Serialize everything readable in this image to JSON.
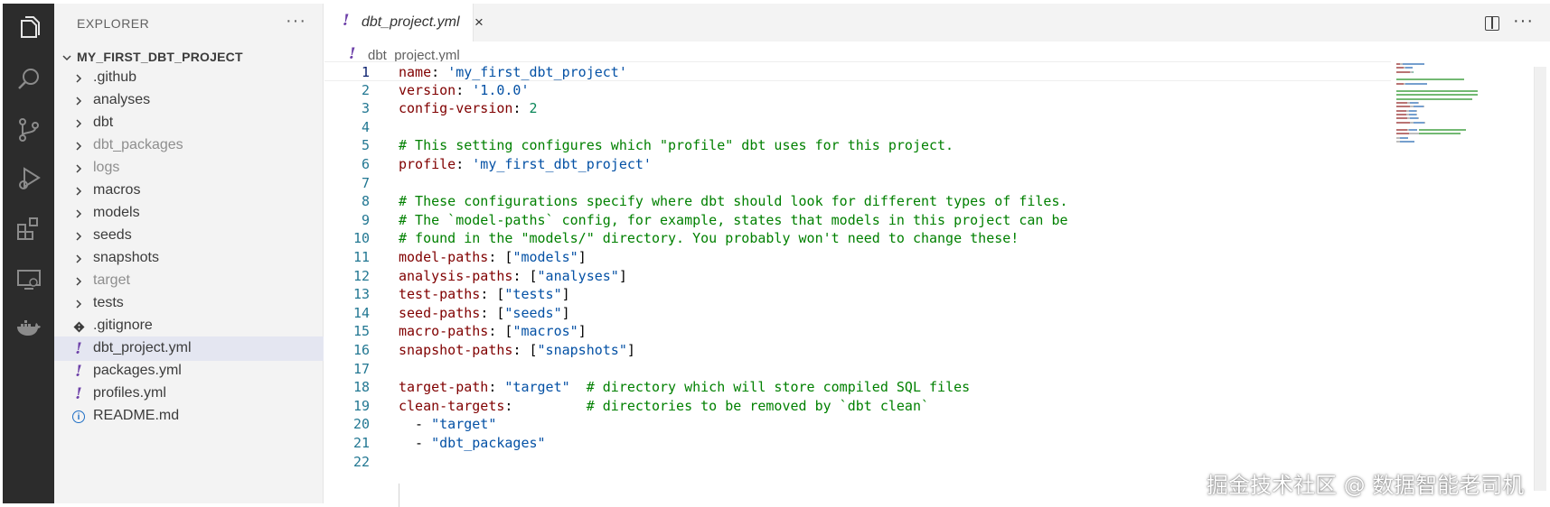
{
  "explorer": {
    "title": "EXPLORER",
    "more": "···",
    "project": "MY_FIRST_DBT_PROJECT",
    "items": [
      {
        "label": ".github",
        "type": "folder",
        "dim": false
      },
      {
        "label": "analyses",
        "type": "folder",
        "dim": false
      },
      {
        "label": "dbt",
        "type": "folder",
        "dim": false
      },
      {
        "label": "dbt_packages",
        "type": "folder",
        "dim": true
      },
      {
        "label": "logs",
        "type": "folder",
        "dim": true
      },
      {
        "label": "macros",
        "type": "folder",
        "dim": false
      },
      {
        "label": "models",
        "type": "folder",
        "dim": false
      },
      {
        "label": "seeds",
        "type": "folder",
        "dim": false
      },
      {
        "label": "snapshots",
        "type": "folder",
        "dim": false
      },
      {
        "label": "target",
        "type": "folder",
        "dim": true
      },
      {
        "label": "tests",
        "type": "folder",
        "dim": false
      },
      {
        "label": ".gitignore",
        "type": "git",
        "dim": false
      },
      {
        "label": "dbt_project.yml",
        "type": "yml",
        "dim": false,
        "selected": true
      },
      {
        "label": "packages.yml",
        "type": "yml",
        "dim": false
      },
      {
        "label": "profiles.yml",
        "type": "yml",
        "dim": false
      },
      {
        "label": "README.md",
        "type": "info",
        "dim": false
      }
    ]
  },
  "activity_bar": {
    "icons": [
      "files-icon",
      "search-icon",
      "source-control-icon",
      "run-debug-icon",
      "extensions-icon",
      "remote-explorer-icon",
      "docker-icon"
    ]
  },
  "editor": {
    "tab_label": "dbt_project.yml",
    "tab_close": "×",
    "breadcrumb": "dbt_project.yml",
    "more": "···",
    "yml_glyph": "!",
    "lines": [
      {
        "n": "1",
        "tokens": [
          [
            "k",
            "name"
          ],
          [
            "p",
            ": "
          ],
          [
            "s",
            "'my_first_dbt_project'"
          ]
        ],
        "current": true
      },
      {
        "n": "2",
        "tokens": [
          [
            "k",
            "version"
          ],
          [
            "p",
            ": "
          ],
          [
            "s",
            "'1.0.0'"
          ]
        ]
      },
      {
        "n": "3",
        "tokens": [
          [
            "k",
            "config-version"
          ],
          [
            "p",
            ": "
          ],
          [
            "n",
            "2"
          ]
        ]
      },
      {
        "n": "4",
        "tokens": []
      },
      {
        "n": "5",
        "tokens": [
          [
            "c",
            "# This setting configures which \"profile\" dbt uses for this project."
          ]
        ]
      },
      {
        "n": "6",
        "tokens": [
          [
            "k",
            "profile"
          ],
          [
            "p",
            ": "
          ],
          [
            "s",
            "'my_first_dbt_project'"
          ]
        ]
      },
      {
        "n": "7",
        "tokens": []
      },
      {
        "n": "8",
        "tokens": [
          [
            "c",
            "# These configurations specify where dbt should look for different types of files."
          ]
        ]
      },
      {
        "n": "9",
        "tokens": [
          [
            "c",
            "# The `model-paths` config, for example, states that models in this project can be"
          ]
        ]
      },
      {
        "n": "10",
        "tokens": [
          [
            "c",
            "# found in the \"models/\" directory. You probably won't need to change these!"
          ]
        ]
      },
      {
        "n": "11",
        "tokens": [
          [
            "k",
            "model-paths"
          ],
          [
            "p",
            ": ["
          ],
          [
            "s",
            "\"models\""
          ],
          [
            "p",
            "]"
          ]
        ]
      },
      {
        "n": "12",
        "tokens": [
          [
            "k",
            "analysis-paths"
          ],
          [
            "p",
            ": ["
          ],
          [
            "s",
            "\"analyses\""
          ],
          [
            "p",
            "]"
          ]
        ]
      },
      {
        "n": "13",
        "tokens": [
          [
            "k",
            "test-paths"
          ],
          [
            "p",
            ": ["
          ],
          [
            "s",
            "\"tests\""
          ],
          [
            "p",
            "]"
          ]
        ]
      },
      {
        "n": "14",
        "tokens": [
          [
            "k",
            "seed-paths"
          ],
          [
            "p",
            ": ["
          ],
          [
            "s",
            "\"seeds\""
          ],
          [
            "p",
            "]"
          ]
        ]
      },
      {
        "n": "15",
        "tokens": [
          [
            "k",
            "macro-paths"
          ],
          [
            "p",
            ": ["
          ],
          [
            "s",
            "\"macros\""
          ],
          [
            "p",
            "]"
          ]
        ]
      },
      {
        "n": "16",
        "tokens": [
          [
            "k",
            "snapshot-paths"
          ],
          [
            "p",
            ": ["
          ],
          [
            "s",
            "\"snapshots\""
          ],
          [
            "p",
            "]"
          ]
        ]
      },
      {
        "n": "17",
        "tokens": []
      },
      {
        "n": "18",
        "tokens": [
          [
            "k",
            "target-path"
          ],
          [
            "p",
            ": "
          ],
          [
            "s",
            "\"target\""
          ],
          [
            "p",
            "  "
          ],
          [
            "c",
            "# directory which will store compiled SQL files"
          ]
        ]
      },
      {
        "n": "19",
        "tokens": [
          [
            "k",
            "clean-targets"
          ],
          [
            "p",
            ":         "
          ],
          [
            "c",
            "# directories to be removed by `dbt clean`"
          ]
        ]
      },
      {
        "n": "20",
        "tokens": [
          [
            "p",
            "  - "
          ],
          [
            "s",
            "\"target\""
          ]
        ]
      },
      {
        "n": "21",
        "tokens": [
          [
            "p",
            "  - "
          ],
          [
            "s",
            "\"dbt_packages\""
          ]
        ]
      },
      {
        "n": "22",
        "tokens": []
      }
    ]
  },
  "colors": {
    "activity_bar": "#2c2c2c",
    "sidebar": "#f3f3f3",
    "key": "#800000",
    "string": "#0451a5",
    "number": "#098658",
    "comment": "#008000",
    "line_number": "#237893",
    "yml_glyph": "#6c3fa8"
  },
  "watermark": "掘金技术社区 @ 数据智能老司机"
}
